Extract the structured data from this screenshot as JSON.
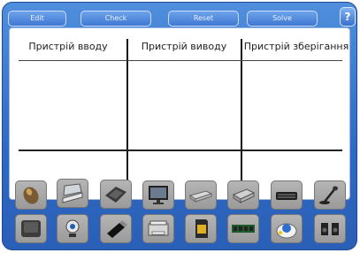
{
  "toolbar": {
    "edit_label": "Edit",
    "check_label": "Check",
    "reset_label": "Reset",
    "solve_label": "Solve",
    "help_label": "?"
  },
  "columns": [
    {
      "header": "Пристрій вводу"
    },
    {
      "header": "Пристрій виводу"
    },
    {
      "header": "Пристрій зберігання"
    }
  ],
  "tray_items_row1": [
    "mouse-icon",
    "scanner-icon",
    "tablet-icon",
    "monitor-icon",
    "dvd-drive-icon",
    "printer-icon",
    "keyboard-icon",
    "microphone-icon"
  ],
  "tray_items_row2": [
    "touchpad-icon",
    "webcam-icon",
    "usb-flash-drive-icon",
    "multifunction-printer-icon",
    "sd-card-icon",
    "ram-module-icon",
    "trackball-icon",
    "speakers-icon"
  ]
}
